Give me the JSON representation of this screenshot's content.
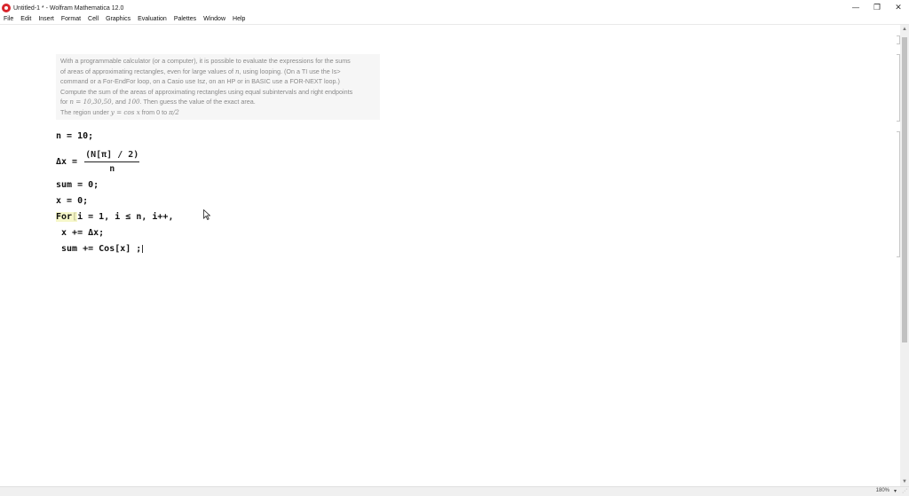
{
  "window": {
    "title": "Untitled-1 * - Wolfram Mathematica 12.0",
    "minimize": "—",
    "maximize": "❐",
    "close": "✕"
  },
  "menu": [
    "File",
    "Edit",
    "Insert",
    "Format",
    "Cell",
    "Graphics",
    "Evaluation",
    "Palettes",
    "Window",
    "Help"
  ],
  "text_cell": {
    "lines": [
      "With a programmable calculator (or a computer), it is possible to evaluate the expressions for the sums",
      "of areas of approximating rectangles, even for large values of",
      "command or a For-EndFor loop, on a Casio use Isz, on an HP or in BASIC use a FOR-NEXT loop.)",
      "Compute the sum of the areas of approximating rectangles using equal subintervals and right endpoints",
      "for",
      "The region under"
    ],
    "line2_var": "n",
    "line2_rest": ", using looping. (On a TI use the Is>",
    "line5_eq": "n = 10,30,50,",
    "line5_and": " and ",
    "line5_val": "100",
    "line5_rest": ". Then guess the value of the exact area.",
    "line6_fn": "y = cos x",
    "line6_from": " from 0 to ",
    "line6_upper": "π/2"
  },
  "code": {
    "line1": "n = 10;",
    "dx_lhs": "Δx =",
    "dx_num": "(N[π] / 2)",
    "dx_den": "n",
    "line3": "sum = 0;",
    "line4": "x = 0;",
    "for_kw": "For",
    "for_bracket": "[",
    "for_rest": "i = 1, i ≤ n, i++,",
    "line6": " x += Δx;",
    "line7": " sum += Cos[x] ;"
  },
  "status": {
    "zoom": "180%",
    "zoom_arrow": "▾"
  }
}
